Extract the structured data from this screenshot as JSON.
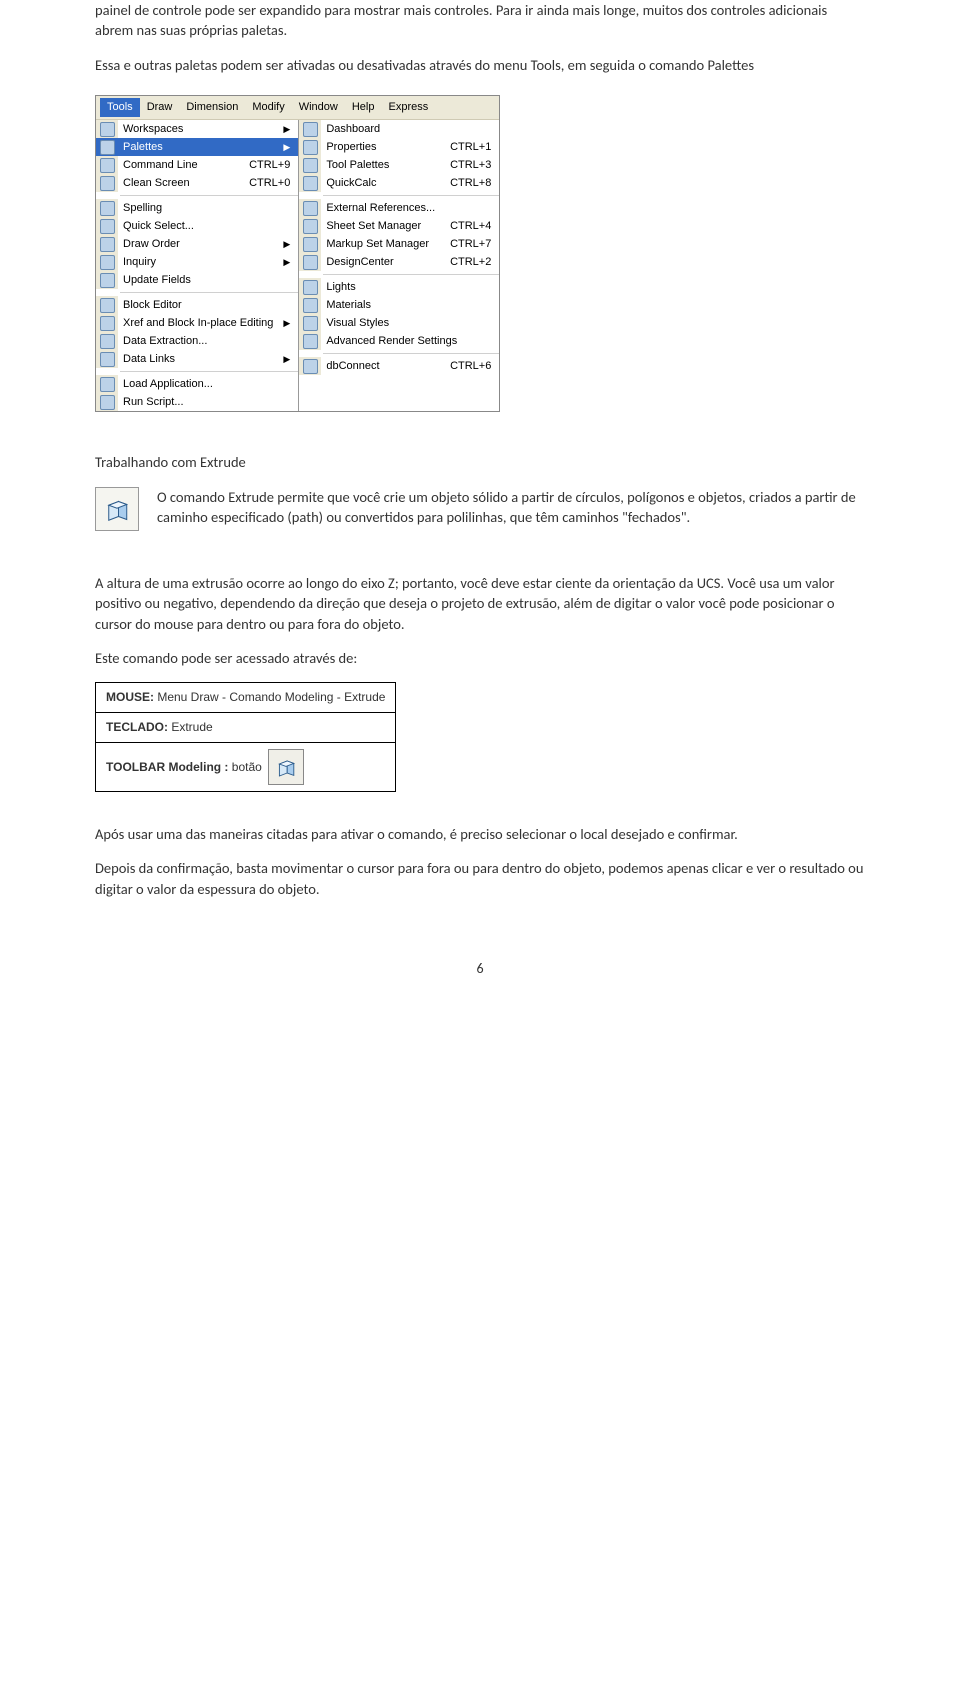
{
  "paragraphs": {
    "p1": "painel de controle pode ser expandido para mostrar mais controles. Para ir ainda mais longe, muitos dos controles adicionais abrem nas suas próprias paletas.",
    "p2": "Essa e outras paletas podem ser ativadas ou desativadas através do menu Tools, em seguida o comando Palettes",
    "h1": "Trabalhando com Extrude",
    "extrude_desc": "O comando Extrude permite que você crie um objeto sólido a partir de círculos, polígonos e objetos, criados a partir de caminho especificado (path) ou convertidos para polilinhas, que têm caminhos \"fechados\".",
    "p3": "A altura de uma extrusão ocorre ao longo do eixo Z; portanto, você deve estar ciente da orientação da UCS. Você usa um valor positivo ou negativo, dependendo da direção que deseja o projeto de extrusão, além de digitar o valor você pode posicionar o cursor do mouse para dentro ou para fora do objeto.",
    "p4": "Este comando pode ser acessado através de:",
    "p5": "Após usar uma das maneiras citadas para ativar o comando, é preciso selecionar o local desejado e confirmar.",
    "p6": "Depois da confirmação, basta movimentar o cursor para fora ou para dentro do objeto, podemos apenas clicar e ver o resultado ou digitar o valor da espessura do objeto."
  },
  "menubar": [
    "Tools",
    "Draw",
    "Dimension",
    "Modify",
    "Window",
    "Help",
    "Express"
  ],
  "menu_left": [
    {
      "label": "Workspaces",
      "arrow": true
    },
    {
      "label": "Palettes",
      "arrow": true,
      "highlight": true
    },
    {
      "label": "Command Line",
      "shortcut": "CTRL+9"
    },
    {
      "label": "Clean Screen",
      "shortcut": "CTRL+0"
    },
    {
      "sep": true
    },
    {
      "label": "Spelling"
    },
    {
      "label": "Quick Select..."
    },
    {
      "label": "Draw Order",
      "arrow": true
    },
    {
      "label": "Inquiry",
      "arrow": true
    },
    {
      "label": "Update Fields"
    },
    {
      "sep": true
    },
    {
      "label": "Block Editor"
    },
    {
      "label": "Xref and Block In-place Editing",
      "arrow": true
    },
    {
      "label": "Data Extraction..."
    },
    {
      "label": "Data Links",
      "arrow": true
    },
    {
      "sep": true
    },
    {
      "label": "Load Application..."
    },
    {
      "label": "Run Script..."
    }
  ],
  "menu_right": [
    {
      "label": "Dashboard"
    },
    {
      "label": "Properties",
      "shortcut": "CTRL+1"
    },
    {
      "label": "Tool Palettes",
      "shortcut": "CTRL+3"
    },
    {
      "label": "QuickCalc",
      "shortcut": "CTRL+8"
    },
    {
      "sep": true
    },
    {
      "label": "External References..."
    },
    {
      "label": "Sheet Set Manager",
      "shortcut": "CTRL+4"
    },
    {
      "label": "Markup Set Manager",
      "shortcut": "CTRL+7"
    },
    {
      "label": "DesignCenter",
      "shortcut": "CTRL+2"
    },
    {
      "sep": true
    },
    {
      "label": "Lights"
    },
    {
      "label": "Materials"
    },
    {
      "label": "Visual Styles"
    },
    {
      "label": "Advanced Render Settings"
    },
    {
      "sep": true
    },
    {
      "label": "dbConnect",
      "shortcut": "CTRL+6"
    }
  ],
  "access_table": {
    "row1_label": "MOUSE:",
    "row1_val": " Menu Draw - Comando Modeling - Extrude",
    "row2_label": "TECLADO:",
    "row2_val": " Extrude",
    "row3_label": "TOOLBAR Modeling :",
    "row3_val": " botão"
  },
  "page_number": "6"
}
